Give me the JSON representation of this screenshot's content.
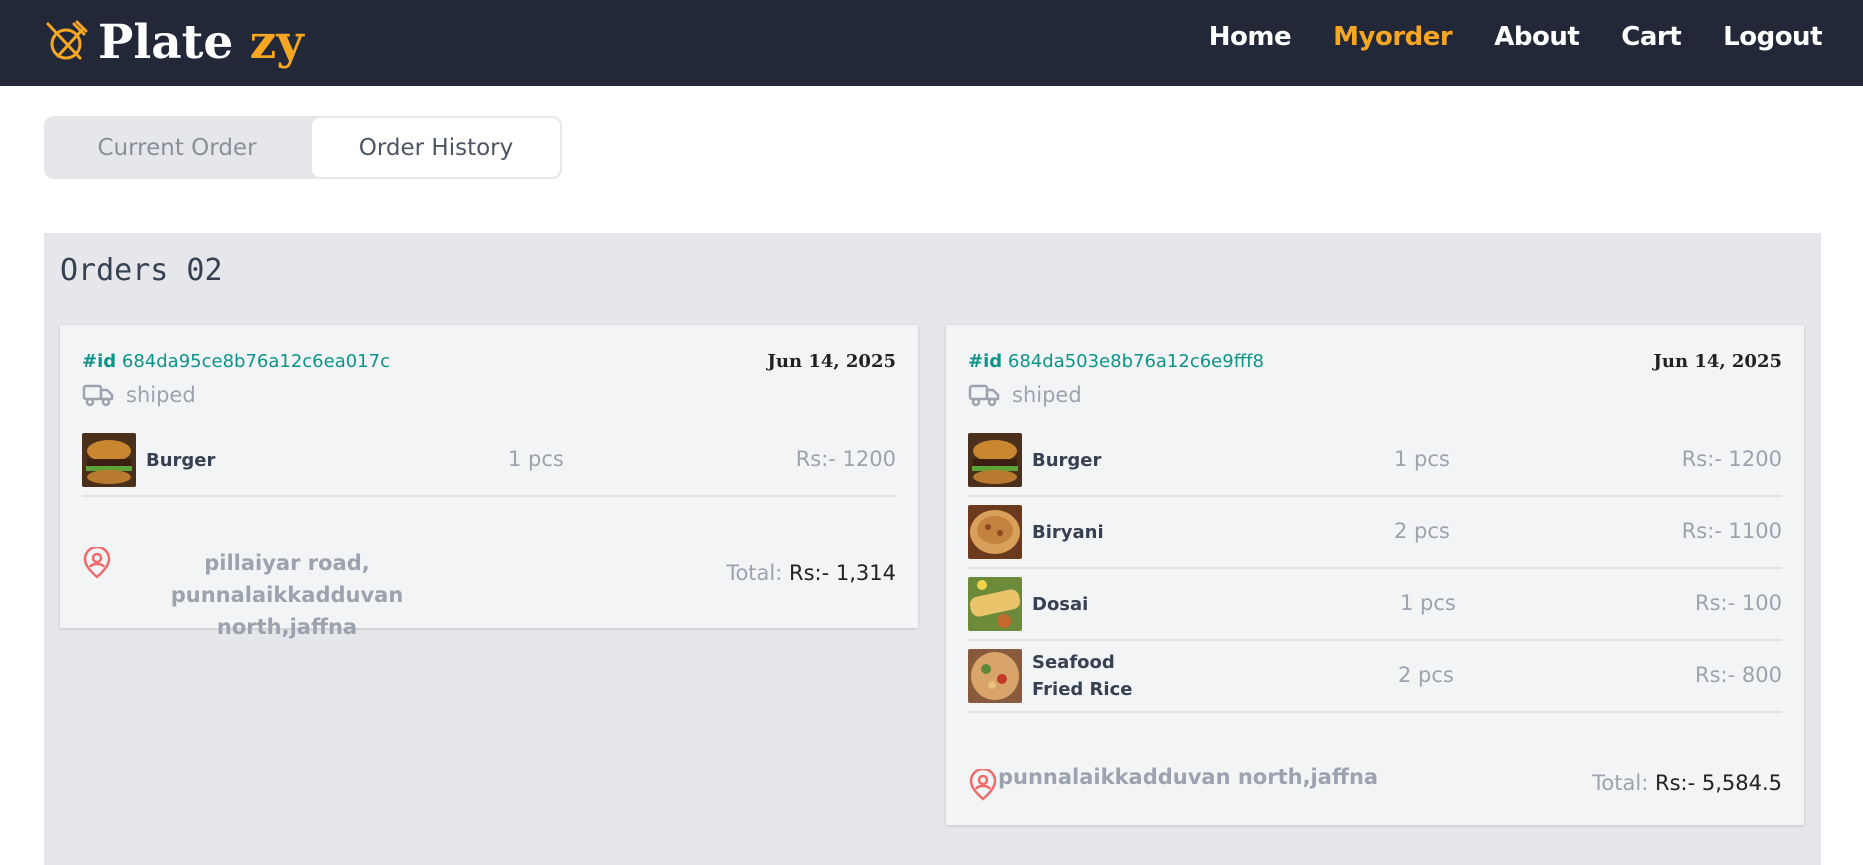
{
  "brand": {
    "name_part1": "Plate",
    "name_part2": "zy"
  },
  "nav": [
    "Home",
    "Myorder",
    "About",
    "Cart",
    "Logout"
  ],
  "tabs": {
    "current": "Current Order",
    "history": "Order History"
  },
  "orders_title": "Orders 02",
  "orders": [
    {
      "id_label": "#id",
      "id": "684da95ce8b76a12c6ea017c",
      "date": "Jun 14, 2025",
      "status": "shiped",
      "items": [
        {
          "name": "Burger",
          "qty": "1 pcs",
          "price": "Rs:- 1200"
        }
      ],
      "address_line1": "pillaiyar road, punnalaikkadduvan",
      "address_line2": "north,jaffna",
      "total_label": "Total:",
      "total": "Rs:- 1,314"
    },
    {
      "id_label": "#id",
      "id": "684da503e8b76a12c6e9fff8",
      "date": "Jun 14, 2025",
      "status": "shiped",
      "items": [
        {
          "name": "Burger",
          "qty": "1 pcs",
          "price": "Rs:- 1200"
        },
        {
          "name": "Biryani",
          "qty": "2 pcs",
          "price": "Rs:- 1100"
        },
        {
          "name": "Dosai",
          "qty": "1 pcs",
          "price": "Rs:- 100"
        },
        {
          "name_line1": "Seafood",
          "name_line2": "Fried Rice",
          "qty": "2 pcs",
          "price": "Rs:- 800"
        }
      ],
      "address": "punnalaikkadduvan north,jaffna",
      "total_label": "Total:",
      "total": "Rs:- 5,584.5"
    }
  ],
  "colors": {
    "navbar": "#222838",
    "accent": "#f5a623",
    "id_teal": "#0d9488",
    "pin_red": "#ef6b6b"
  }
}
